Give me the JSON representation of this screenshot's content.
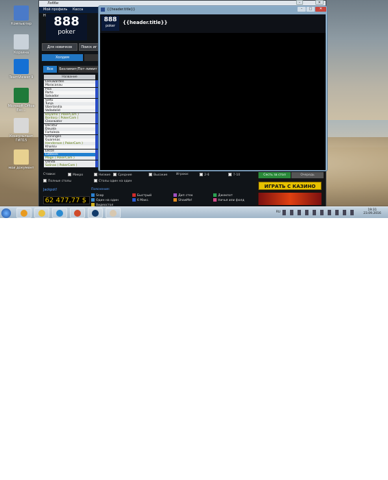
{
  "desktop": {
    "icons": [
      {
        "label": "Компьютер",
        "color": "#4a7ac8",
        "icon": "computer-icon"
      },
      {
        "label": "Корзина",
        "color": "#c9d2da",
        "icon": "recycle-bin-icon"
      },
      {
        "label": "TeamViewer 9",
        "color": "#1570d4",
        "icon": "teamviewer-icon"
      },
      {
        "label": "Microsoft Office Exc...",
        "color": "#1f7a3a",
        "icon": "excel-icon"
      },
      {
        "label": "Консультант ГИП15",
        "color": "#d8d8d8",
        "icon": "consultant-icon"
      },
      {
        "label": "мои документ",
        "color": "#e8d190",
        "icon": "folder-icon"
      }
    ]
  },
  "lobby": {
    "window_title": "Лобби",
    "menu": [
      "Мой профиль",
      "Касса",
      "Начать"
    ],
    "logo_digits": "888",
    "logo_word": "poker",
    "top_tabs": [
      "Для новичков",
      "Поиск иг"
    ],
    "game_tabs": [
      "Холдем",
      ""
    ],
    "filter_tabs": [
      "Все",
      "Безлимит/Пот-лимит"
    ],
    "table_header": "Название",
    "tables": [
      {
        "name": "Leeuwarden",
        "style": "alt"
      },
      {
        "name": "Maracanau",
        "style": "plain"
      },
      {
        "name": "Pisa",
        "style": "alt"
      },
      {
        "name": "Porto",
        "style": "plain"
      },
      {
        "name": "Salvador",
        "style": "alt"
      },
      {
        "name": "Saltu",
        "style": "plain"
      },
      {
        "name": "Tunja",
        "style": "alt"
      },
      {
        "name": "Uberlandia",
        "style": "plain"
      },
      {
        "name": "Valladolid",
        "style": "alt"
      },
      {
        "name": "Bayamo ( PokerCam )",
        "style": "pc"
      },
      {
        "name": "Bordorp ( PokerCam )",
        "style": "pc"
      },
      {
        "name": "Clearwater",
        "style": "alt"
      },
      {
        "name": "Decatur",
        "style": "plain"
      },
      {
        "name": "Douala",
        "style": "alt"
      },
      {
        "name": "Fortaleza",
        "style": "plain"
      },
      {
        "name": "Groningen",
        "style": "alt"
      },
      {
        "name": "Guarenas",
        "style": "plain"
      },
      {
        "name": "Henderson ( PokerCam )",
        "style": "pc"
      },
      {
        "name": "Kharkiv",
        "style": "plain"
      },
      {
        "name": "Lecce",
        "style": "alt"
      },
      {
        "name": "Lubbock",
        "style": "sel"
      },
      {
        "name": "Mage ( PokerCam )",
        "style": "pc"
      },
      {
        "name": "Olinda",
        "style": "alt"
      },
      {
        "name": "Salinas ( PokerCam )",
        "style": "pc"
      }
    ],
    "stakes_label": "Ставки:",
    "stakes": [
      "Микро",
      "Низкие",
      "Средние",
      "Высокие"
    ],
    "players_label": "Игроки:",
    "players": [
      "2-6",
      "7-10"
    ],
    "full_tables": "Полные столы",
    "one_on_one": "Столы один на один",
    "jackpot_label": "Jackpot!",
    "jackpot_value": "62 477,77 $",
    "legend_title": "Пояснения:",
    "legend": [
      {
        "label": "Snap",
        "color": "#2a7fd0"
      },
      {
        "label": "Быстрый",
        "color": "#d02a2a"
      },
      {
        "label": "Дип стек",
        "color": "#a050c0"
      },
      {
        "label": "Джекпот",
        "color": "#2aa050"
      },
      {
        "label": "Один на один",
        "color": "#3a8ad0"
      },
      {
        "label": "6 Макс.",
        "color": "#2a5ad0"
      },
      {
        "label": "ShowMe!",
        "color": "#e08a20"
      },
      {
        "label": "Ничья или фолд",
        "color": "#d04a8a"
      },
      {
        "label": "Видеостол",
        "color": "#d0b020"
      }
    ],
    "sit_button": "Сесть за стол",
    "waitlist_button": "Очередь",
    "casino_banner": "ИГРАТЬ С КАЗИНО"
  },
  "front_window": {
    "titlebar_text": "{{header.title}}",
    "header_title": "{{header.title}}",
    "logo_digits": "888",
    "logo_word": "poker"
  },
  "taskbar": {
    "time": "19:31",
    "date": "23.09.2016",
    "language": "RU",
    "apps": [
      "media-player-icon",
      "explorer-icon",
      "ie-icon",
      "chrome-icon",
      "poker-icon",
      "paint-icon"
    ]
  }
}
